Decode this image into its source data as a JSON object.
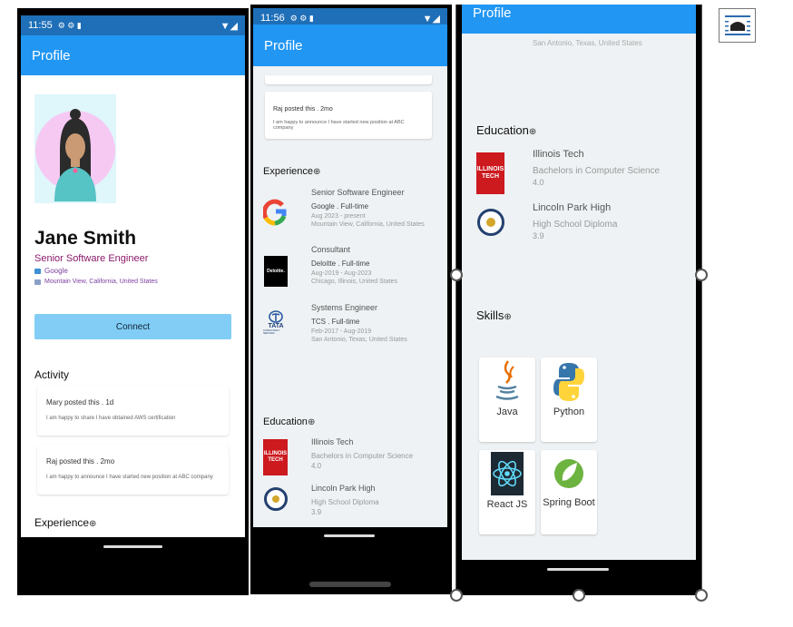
{
  "phone1": {
    "status_time": "11:55",
    "status_icons": "⚙ ⚙ ▮",
    "status_right": "▼◢",
    "app_title": "Profile",
    "name": "Jane Smith",
    "job_title": "Senior Software Engineer",
    "company": "Google",
    "location": "Mountain View, California, United States",
    "connect_label": "Connect",
    "activity_heading": "Activity",
    "posts": [
      {
        "header": "Mary posted this . 1d",
        "body": "I am happy to share I have obtained AWS certification"
      },
      {
        "header": "Raj posted this . 2mo",
        "body": "I am happy to announce I have started new position at ABC company"
      }
    ],
    "experience_heading": "Experience",
    "plus_symbol": "⊕"
  },
  "phone2": {
    "status_time": "11:56",
    "status_icons": "⚙ ⚙ ▮",
    "status_right": "▼◢",
    "app_title": "Profile",
    "post": {
      "header": "Raj posted this . 2mo",
      "body": "I am happy to announce I have started new position at ABC company"
    },
    "experience_heading": "Experience",
    "experience": [
      {
        "title": "Senior Software Engineer",
        "company": "Google . Full-time",
        "dates": "Aug 2023 - present",
        "location": "Mountain View, California, United States",
        "logo": "google-logo"
      },
      {
        "title": "Consultant",
        "company": "Deloitte . Full-time",
        "dates": "Aug-2019 - Aug-2023",
        "location": "Chicago, Illinois, United States",
        "logo": "deloitte-logo",
        "logo_text": "Deloitte."
      },
      {
        "title": "Systems Engineer",
        "company": "TCS . Full-time",
        "dates": "Feb-2017 - Aug-2019",
        "location": "San Antonio, Texas, United States",
        "logo": "tata-logo",
        "logo_text": "TATA",
        "logo_subtext": "CONSULTANCY SERVICES"
      }
    ],
    "education_heading": "Education",
    "education": [
      {
        "school": "Illinois Tech",
        "degree": "Bachelors in Computer Science",
        "gpa": "4.0",
        "logo_text": "ILLINOIS TECH"
      },
      {
        "school": "Lincoln Park High",
        "degree": "High School Diploma",
        "gpa": "3.9"
      }
    ],
    "plus_symbol": "⊕"
  },
  "phone3": {
    "app_title": "Profile",
    "top_location": "San Antonio, Texas, United States",
    "education_heading": "Education",
    "education": [
      {
        "school": "Illinois Tech",
        "degree": "Bachelors in Computer Science",
        "gpa": "4.0",
        "logo_text": "ILLINOIS TECH"
      },
      {
        "school": "Lincoln Park High",
        "degree": "High School Diploma",
        "gpa": "3.9"
      }
    ],
    "skills_heading": "Skills",
    "skills": [
      "Java",
      "Python",
      "React JS",
      "Spring Boot"
    ],
    "plus_symbol": "⊕"
  },
  "colors": {
    "appbar": "#2196f3",
    "statusbar": "#1e6fb8",
    "job_title": "#8b1a6b",
    "company_link": "#7b3fa0",
    "connect_button": "#81cdf6"
  }
}
